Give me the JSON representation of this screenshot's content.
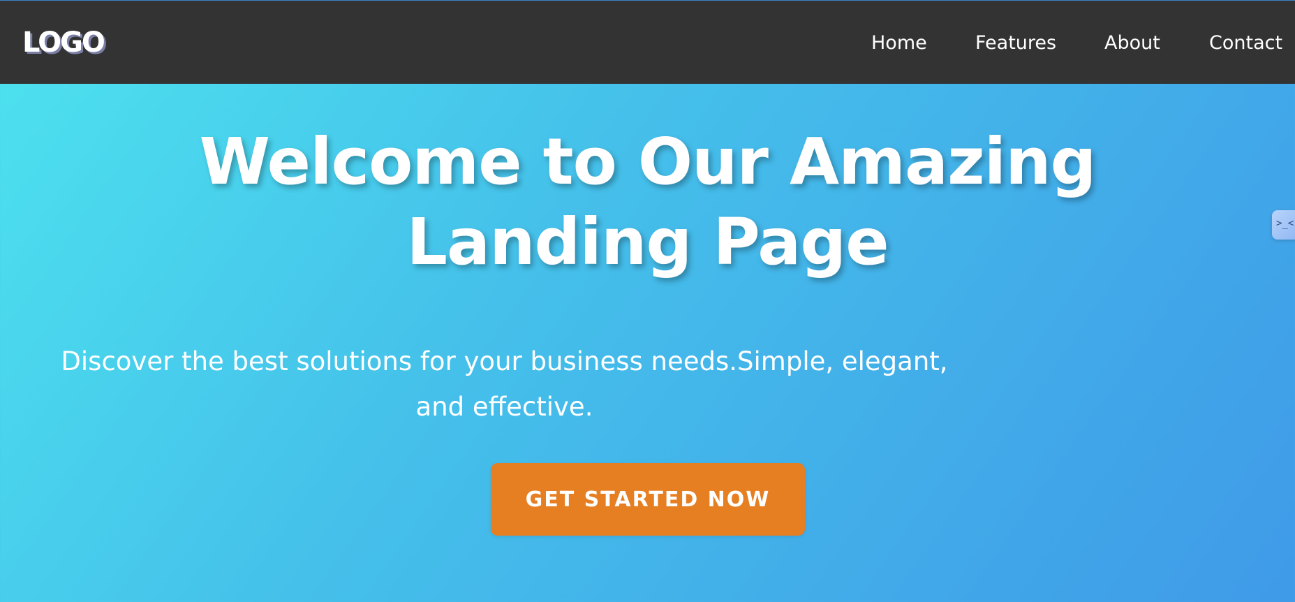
{
  "header": {
    "logo": "LOGO",
    "nav": [
      {
        "label": "Home"
      },
      {
        "label": "Features"
      },
      {
        "label": "About"
      },
      {
        "label": "Contact"
      }
    ]
  },
  "hero": {
    "title": "Welcome to Our Amazing Landing Page",
    "subtitle": "Discover the best solutions for your business needs.Simple, elegant, and effective.",
    "cta_label": "GET STARTED NOW"
  },
  "side_widget": {
    "glyph": ">_<",
    "icon": "assistant-icon"
  },
  "colors": {
    "navbar": "#333333",
    "gradient_start": "#4de3ef",
    "gradient_end": "#3f9ae8",
    "cta": "#e67e22",
    "text": "#ffffff"
  }
}
